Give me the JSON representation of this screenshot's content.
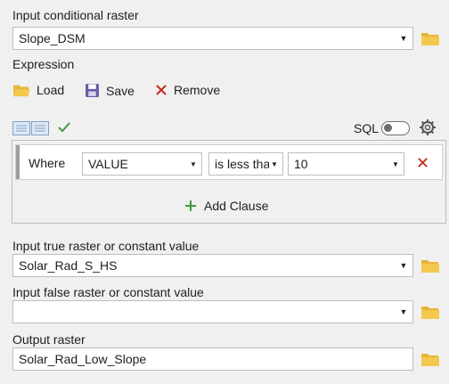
{
  "conditional_raster": {
    "label": "Input conditional raster",
    "value": "Slope_DSM"
  },
  "expression": {
    "label": "Expression",
    "toolbar": {
      "load": "Load",
      "save": "Save",
      "remove": "Remove"
    },
    "sql_label": "SQL",
    "sql_enabled": false,
    "clause": {
      "where_label": "Where",
      "field": "VALUE",
      "operator": "is less tha",
      "value": "10"
    },
    "add_clause_label": "Add Clause"
  },
  "true_raster": {
    "label": "Input true raster or constant value",
    "value": "Solar_Rad_S_HS"
  },
  "false_raster": {
    "label": "Input false raster or constant value",
    "value": ""
  },
  "output_raster": {
    "label": "Output raster",
    "value": "Solar_Rad_Low_Slope"
  },
  "colors": {
    "folder": "#e7b43a",
    "remove_red": "#c42b1c",
    "check_green": "#3f9a3f",
    "add_green": "#3f9a3f",
    "save_purple": "#6a5aa8"
  }
}
